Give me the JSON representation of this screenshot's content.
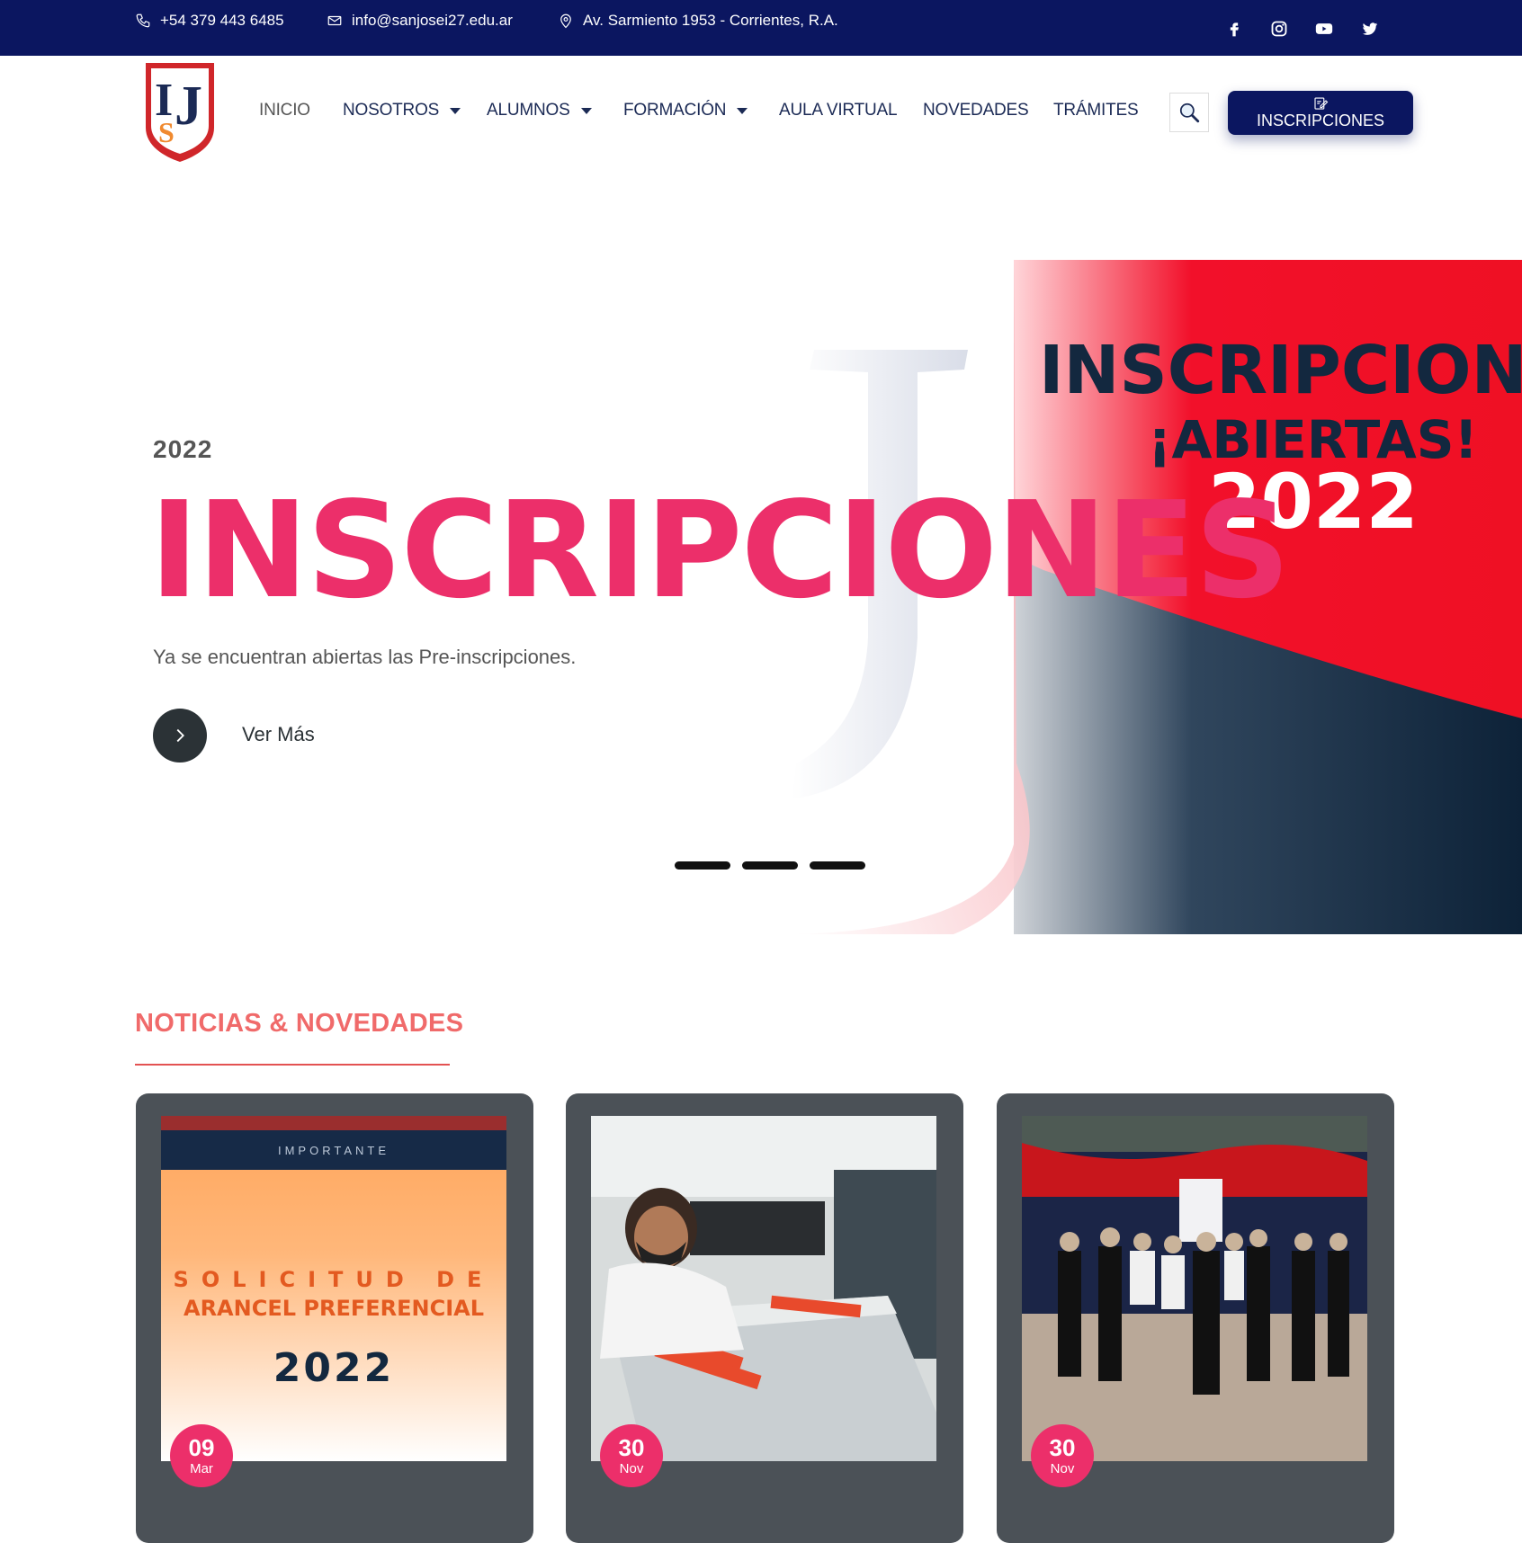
{
  "topbar": {
    "phone": "+54 379 443 6485",
    "email": "info@sanjosei27.edu.ar",
    "address": "Av. Sarmiento 1953 - Corrientes, R.A.",
    "social": [
      "facebook-icon",
      "instagram-icon",
      "youtube-icon",
      "twitter-icon"
    ]
  },
  "logo": {
    "text_top": "I",
    "text_mid": "J",
    "text_s": "S"
  },
  "nav": {
    "items": [
      {
        "label": "INICIO",
        "active": true,
        "dropdown": false
      },
      {
        "label": "NOSOTROS",
        "dropdown": true
      },
      {
        "label": "ALUMNOS",
        "dropdown": true
      },
      {
        "label": "FORMACIÓN",
        "dropdown": true
      },
      {
        "label": "AULA VIRTUAL",
        "dropdown": false
      },
      {
        "label": "NOVEDADES",
        "dropdown": false
      },
      {
        "label": "TRÁMITES",
        "dropdown": false
      }
    ],
    "cta_label": "INSCRIPCIONES"
  },
  "hero": {
    "year": "2022",
    "title": "INSCRIPCIONES",
    "subtitle": "Ya se encuentran abiertas las Pre-inscripciones.",
    "button_label": "Ver Más",
    "banner_line1": "INSCRIPCIONE",
    "banner_line2": "¡ABIERTAS!",
    "banner_year": "2022",
    "slide_count": 3
  },
  "news": {
    "title": "NOTICIAS & NOVEDADES",
    "cards": [
      {
        "day": "09",
        "month": "Mar",
        "tag": "IMPORTANTE",
        "heading1": "SOLICITUD DE",
        "heading2": "ARANCEL PREFERENCIAL",
        "year": "2022"
      },
      {
        "day": "30",
        "month": "Nov"
      },
      {
        "day": "30",
        "month": "Nov"
      }
    ]
  },
  "colors": {
    "navy": "#0b1660",
    "pink": "#ec2f6a",
    "coral": "#f06a6a",
    "red": "#f2102a"
  }
}
